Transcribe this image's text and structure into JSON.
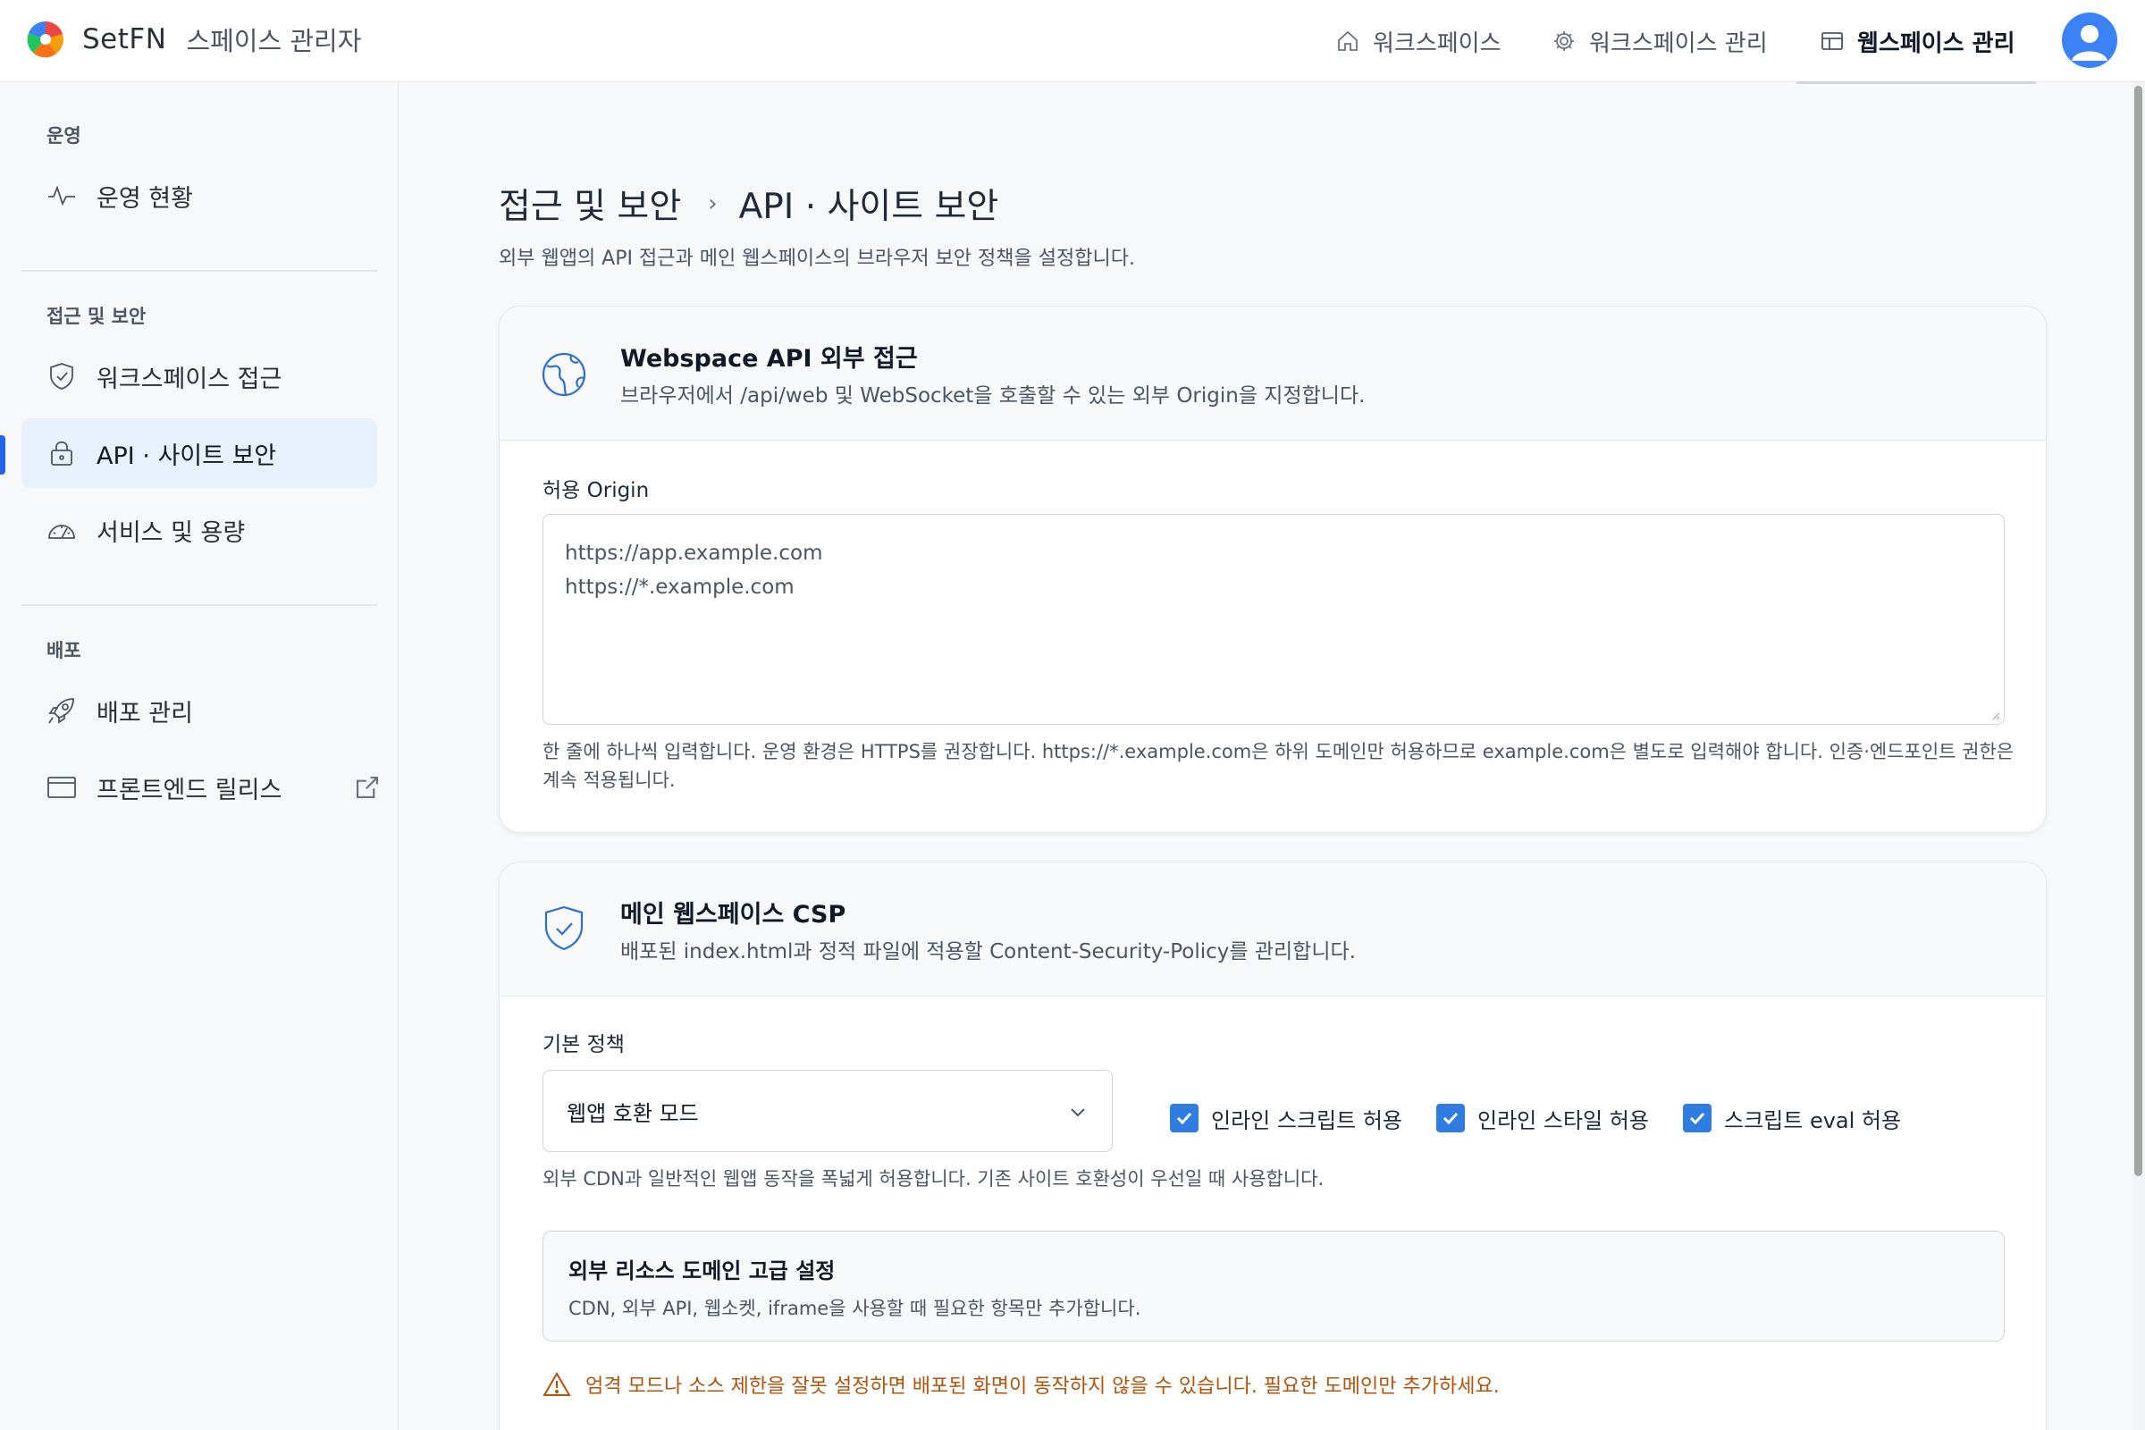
{
  "app": {
    "brand": "SetFN",
    "subtitle": "스페이스 관리자"
  },
  "topnav": {
    "items": [
      {
        "label": "워크스페이스",
        "icon": "home-icon"
      },
      {
        "label": "워크스페이스 관리",
        "icon": "gear-icon"
      },
      {
        "label": "웹스페이스 관리",
        "icon": "layout-icon",
        "active": true
      }
    ]
  },
  "sidebar": {
    "sections": [
      {
        "title": "운영",
        "items": [
          {
            "label": "운영 현황",
            "icon": "activity-icon"
          }
        ]
      },
      {
        "title": "접근 및 보안",
        "items": [
          {
            "label": "워크스페이스 접근",
            "icon": "shield-icon"
          },
          {
            "label": "API · 사이트 보안",
            "icon": "lock-icon",
            "active": true
          },
          {
            "label": "서비스 및 용량",
            "icon": "gauge-icon"
          }
        ]
      },
      {
        "title": "배포",
        "items": [
          {
            "label": "배포 관리",
            "icon": "rocket-icon"
          },
          {
            "label": "프론트엔드 릴리스",
            "icon": "window-icon",
            "external": true
          }
        ]
      }
    ]
  },
  "page": {
    "breadcrumb_parent": "접근 및 보안",
    "breadcrumb_sep": "›",
    "breadcrumb_current": "API · 사이트 보안",
    "description": "외부 웹앱의 API 접근과 메인 웹스페이스의 브라우저 보안 정책을 설정합니다."
  },
  "api_card": {
    "title": "Webspace API 외부 접근",
    "description": "브라우저에서 /api/web 및 WebSocket을 호출할 수 있는 외부 Origin을 지정합니다.",
    "field_label": "허용 Origin",
    "origins": [
      "https://app.example.com",
      "https://*.example.com"
    ],
    "help": "한 줄에 하나씩 입력합니다. 운영 환경은 HTTPS를 권장합니다. https://*.example.com은 하위 도메인만 허용하므로 example.com은 별도로 입력해야 합니다. 인증·엔드포인트 권한은 계속 적용됩니다."
  },
  "csp_card": {
    "title": "메인 웹스페이스 CSP",
    "description": "배포된 index.html과 정적 파일에 적용할 Content-Security-Policy를 관리합니다.",
    "policy_label": "기본 정책",
    "policy_value": "웹앱 호환 모드",
    "checkboxes": [
      {
        "label": "인라인 스크립트 허용",
        "checked": true
      },
      {
        "label": "인라인 스타일 허용",
        "checked": true
      },
      {
        "label": "스크립트 eval 허용",
        "checked": true
      }
    ],
    "policy_help": "외부 CDN과 일반적인 웹앱 동작을 폭넓게 허용합니다. 기존 사이트 호환성이 우선일 때 사용합니다.",
    "advanced": {
      "title": "외부 리소스 도메인 고급 설정",
      "description": "CDN, 외부 API, 웹소켓, iframe을 사용할 때 필요한 항목만 추가합니다."
    },
    "warning": "엄격 모드나 소스 제한을 잘못 설정하면 배포된 화면이 동작하지 않을 수 있습니다. 필요한 도메인만 추가하세요."
  },
  "colors": {
    "accent": "#2563eb",
    "active_bg": "#e8f0fd",
    "checkbox": "#2f7de1",
    "warning": "#b45309"
  }
}
